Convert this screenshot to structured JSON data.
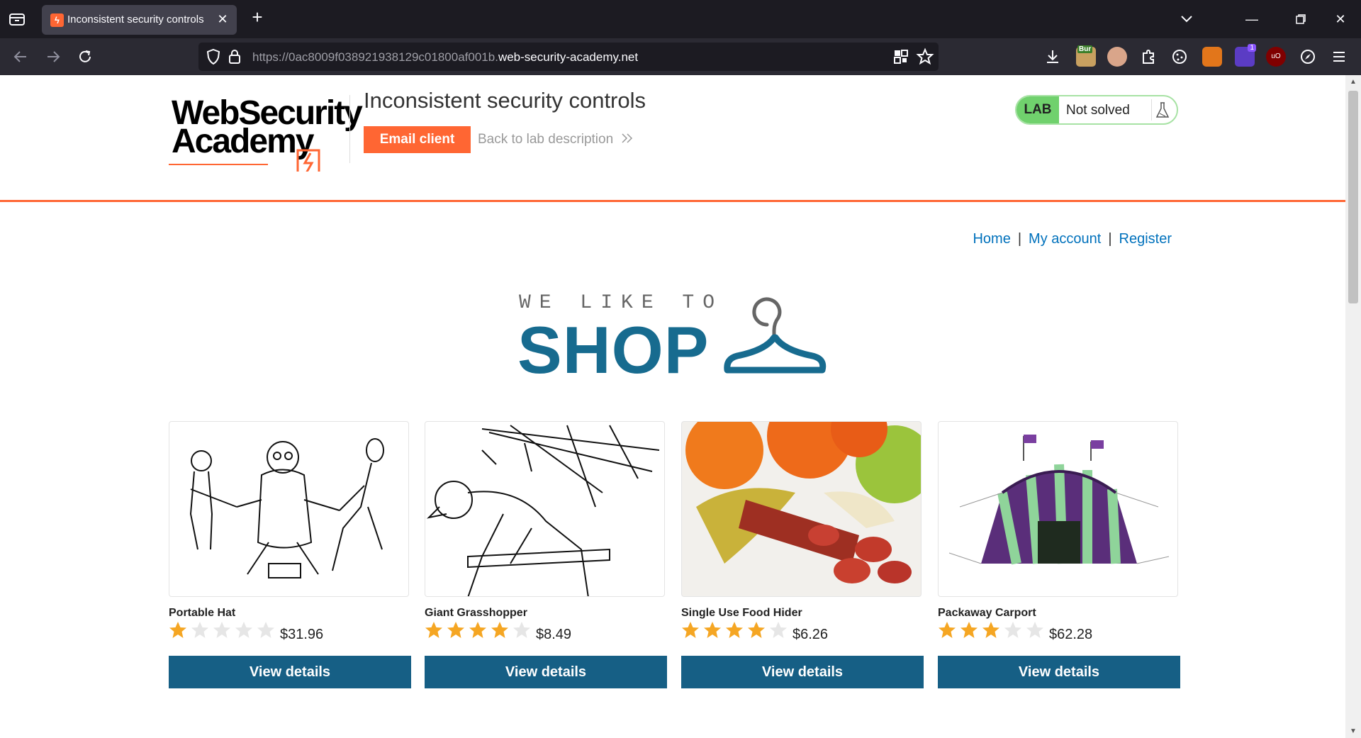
{
  "browser": {
    "tab_title": "Inconsistent security controls",
    "url_prefix": "https://0ac8009f038921938129c01800af001b.",
    "url_host": "web-security-academy.net"
  },
  "header": {
    "logo_line1": "WebSecurity",
    "logo_line2": "Academy",
    "lab_title": "Inconsistent security controls",
    "email_client_label": "Email client",
    "back_link_label": "Back to lab description",
    "lab_tag": "LAB",
    "lab_state": "Not solved"
  },
  "topnav": {
    "home": "Home",
    "my_account": "My account",
    "register": "Register",
    "separator": "|"
  },
  "banner": {
    "small_text": "WE LIKE TO",
    "big_text": "SHOP"
  },
  "products": [
    {
      "name": "Portable Hat",
      "price": "$31.96",
      "rating": 1,
      "button": "View details"
    },
    {
      "name": "Giant Grasshopper",
      "price": "$8.49",
      "rating": 4,
      "button": "View details"
    },
    {
      "name": "Single Use Food Hider",
      "price": "$6.26",
      "rating": 4,
      "button": "View details"
    },
    {
      "name": "Packaway Carport",
      "price": "$62.28",
      "rating": 3,
      "button": "View details"
    }
  ],
  "colors": {
    "accent": "#ff6633",
    "link": "#0071bc",
    "button": "#165f85",
    "star_on": "#f5a623",
    "star_off": "#e6e6e6"
  }
}
